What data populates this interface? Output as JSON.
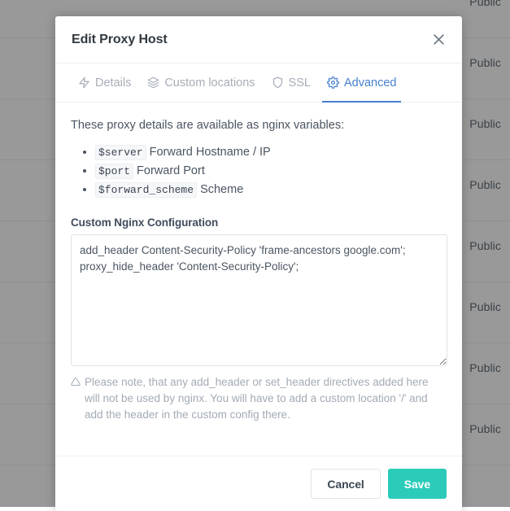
{
  "background": {
    "rows": [
      {
        "label": "Public"
      },
      {
        "label": "Public"
      },
      {
        "label": "Public"
      },
      {
        "label": "Public"
      },
      {
        "label": "Public"
      },
      {
        "label": "Public"
      },
      {
        "label": "Public"
      },
      {
        "label": "Public"
      }
    ]
  },
  "modal": {
    "title": "Edit Proxy Host",
    "close_label": "×",
    "tabs": [
      {
        "label": "Details",
        "icon": "zap-icon",
        "active": false
      },
      {
        "label": "Custom locations",
        "icon": "layers-icon",
        "active": false
      },
      {
        "label": "SSL",
        "icon": "shield-icon",
        "active": false
      },
      {
        "label": "Advanced",
        "icon": "gear-icon",
        "active": true
      }
    ],
    "advanced": {
      "intro": "These proxy details are available as nginx variables:",
      "variables": [
        {
          "code": "$server",
          "description": "Forward Hostname / IP"
        },
        {
          "code": "$port",
          "description": "Forward Port"
        },
        {
          "code": "$forward_scheme",
          "description": "Scheme"
        }
      ],
      "config_label": "Custom Nginx Configuration",
      "config_value": "add_header Content-Security-Policy 'frame-ancestors google.com';\nproxy_hide_header 'Content-Security-Policy';",
      "config_placeholder": "",
      "note": "Please note, that any add_header or set_header directives added here will not be used by nginx. You will have to add a custom location '/' and add the header in the custom config there."
    },
    "footer": {
      "cancel_label": "Cancel",
      "save_label": "Save"
    }
  },
  "colors": {
    "accent_blue": "#467fcf",
    "save_teal": "#2bcbba",
    "text_dark": "#32393f",
    "text_muted": "#a7aeb8",
    "note_gray": "#a3abb5"
  }
}
